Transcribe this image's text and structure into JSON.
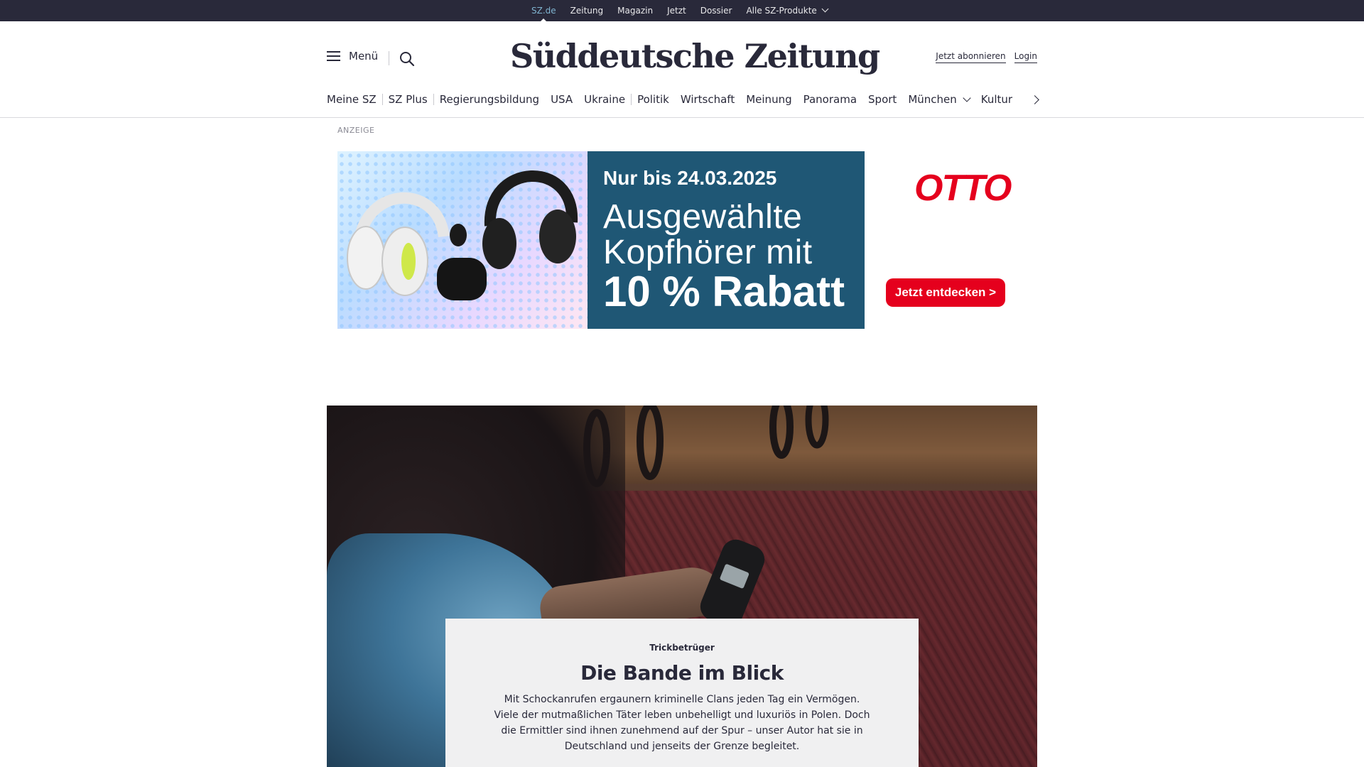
{
  "topbar": {
    "links": [
      "SZ.de",
      "Zeitung",
      "Magazin",
      "Jetzt",
      "Dossier",
      "Alle SZ-Produkte"
    ]
  },
  "header": {
    "menu_label": "Menü",
    "logo_text": "Süddeutsche Zeitung",
    "subscribe_label": "Jetzt abonnieren",
    "login_label": "Login"
  },
  "nav": {
    "items": [
      "Meine SZ",
      "SZ Plus",
      "Regierungsbildung",
      "USA",
      "Ukraine",
      "Politik",
      "Wirtschaft",
      "Meinung",
      "Panorama",
      "Sport",
      "München",
      "Kultur"
    ]
  },
  "ad": {
    "label": "ANZEIGE",
    "date_line": "Nur bis 24.03.2025",
    "headline_1": "Ausgewählte",
    "headline_2": "Kopfhörer mit",
    "headline_3": "10 % Rabatt",
    "brand": "OTTO",
    "cta": "Jetzt entdecken >"
  },
  "teaser": {
    "kicker": "Trickbetrüger",
    "title": "Die Bande im Blick",
    "text": "Mit Schockanrufen ergaunern kriminelle Clans jeden Tag ein Vermögen. Viele der mutmaßlichen Täter leben unbehelligt und luxuriös in Polen.  Doch die Ermittler sind ihnen zunehmend auf der Spur – unser Autor hat sie in Deutschland und jenseits der Grenze begleitet."
  },
  "colors": {
    "topbar_bg": "#29293a",
    "active_link": "#7fb3cf",
    "ad_blue": "#1f5775",
    "otto_red": "#e5001d",
    "teaser_bg": "#f0f0f1"
  }
}
